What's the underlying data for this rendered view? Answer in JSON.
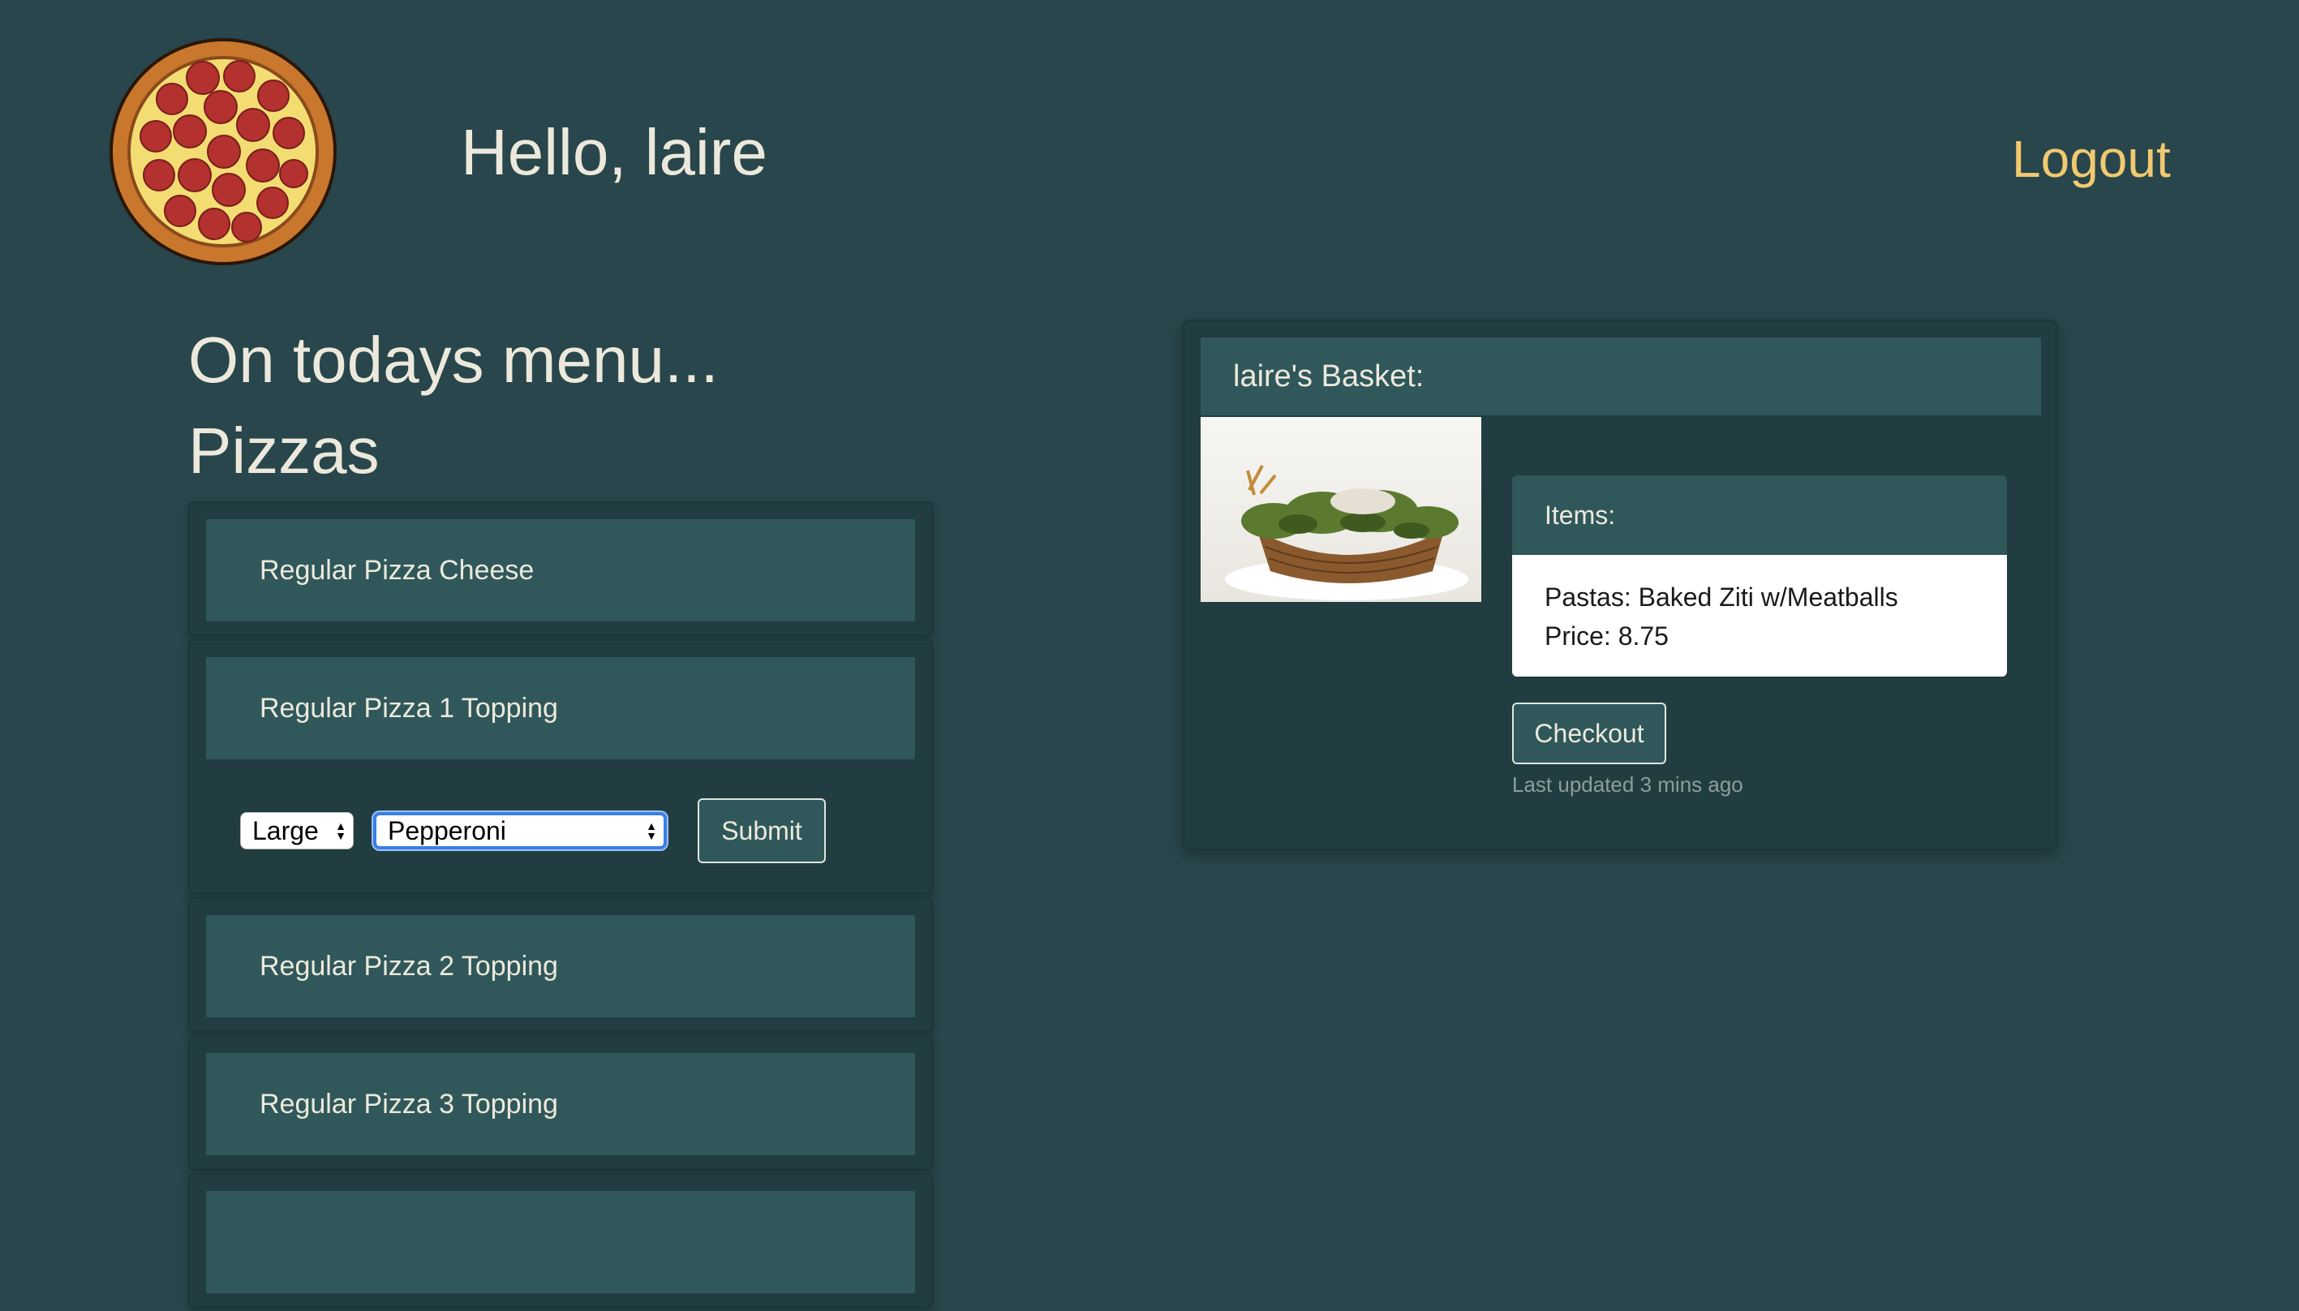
{
  "header": {
    "greeting": "Hello, laire",
    "logout_label": "Logout"
  },
  "menu": {
    "heading": "On todays menu...",
    "category": "Pizzas",
    "items": [
      {
        "label": "Regular Pizza Cheese"
      },
      {
        "label": "Regular Pizza 1 Topping"
      },
      {
        "label": "Regular Pizza 2 Topping"
      },
      {
        "label": "Regular Pizza 3 Topping"
      }
    ],
    "order_form": {
      "size_selected": "Large",
      "topping_selected": "Pepperoni",
      "submit_label": "Submit"
    }
  },
  "basket": {
    "title": "laire's Basket:",
    "items_label": "Items:",
    "item_line": "Pastas: Baked Ziti w/Meatballs",
    "price_line": "Price: 8.75",
    "checkout_label": "Checkout",
    "last_updated": "Last updated 3 mins ago"
  },
  "colors": {
    "background": "#28464b",
    "card": "#213d41",
    "card_header": "#30585b",
    "accent_logout": "#f2c970",
    "text": "#ece9dc"
  },
  "icons": {
    "logo": "pepperoni-pizza-icon",
    "basket_image": "wicker-basket-image"
  }
}
